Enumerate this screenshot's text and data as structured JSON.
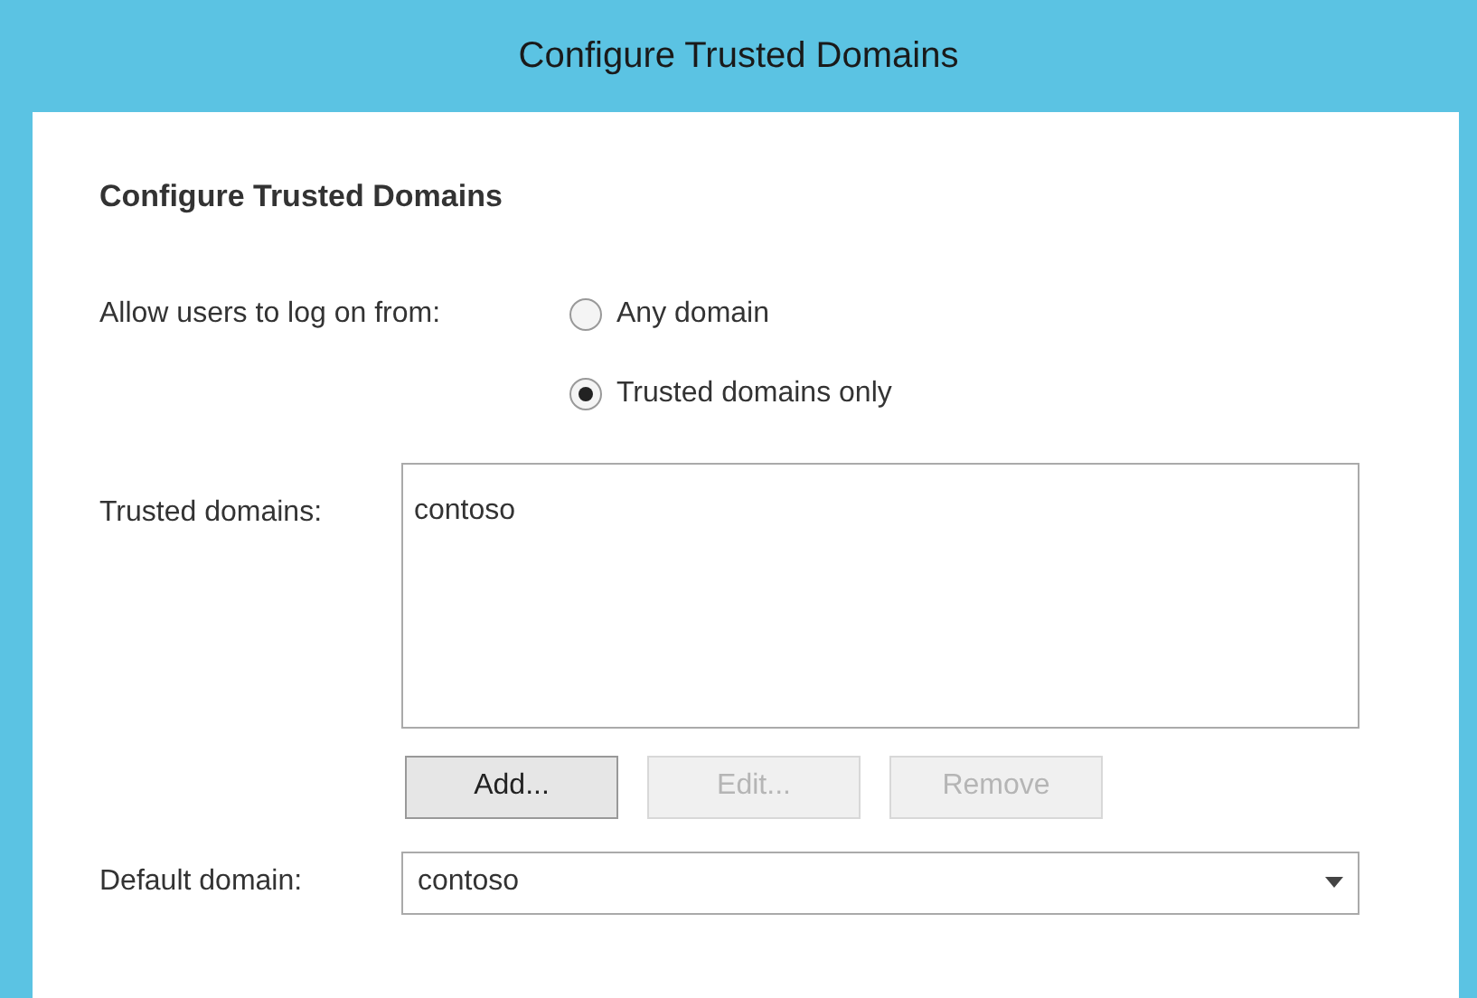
{
  "window": {
    "title": "Configure Trusted Domains"
  },
  "heading": "Configure Trusted Domains",
  "logon": {
    "label": "Allow users to log on from:",
    "options": [
      {
        "label": "Any domain",
        "selected": false
      },
      {
        "label": "Trusted domains only",
        "selected": true
      }
    ]
  },
  "trusted_domains": {
    "label": "Trusted domains:",
    "items": [
      "contoso"
    ]
  },
  "buttons": [
    {
      "label": "Add...",
      "disabled": false
    },
    {
      "label": "Edit...",
      "disabled": true
    },
    {
      "label": "Remove",
      "disabled": true
    }
  ],
  "default_domain": {
    "label": "Default domain:",
    "value": "contoso"
  }
}
